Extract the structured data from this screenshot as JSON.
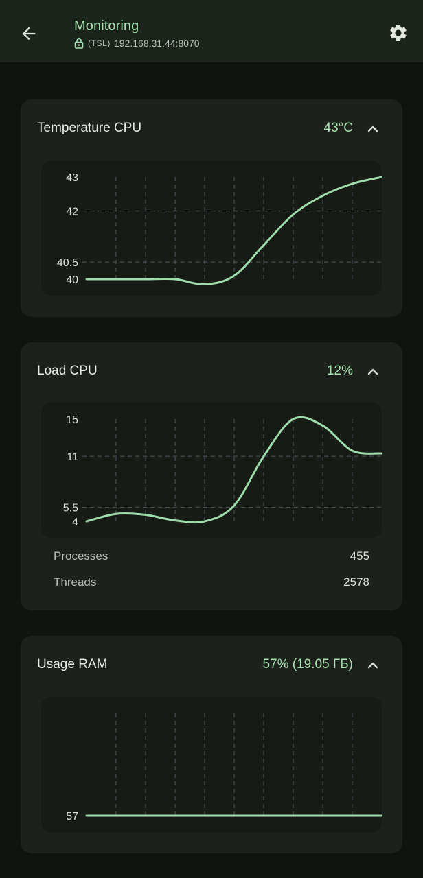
{
  "app_bar": {
    "title": "Monitoring",
    "protocol": "(TSL)",
    "address": "192.168.31.44:8070",
    "back_icon": "arrow-left-icon",
    "settings_icon": "gear-icon",
    "lock_icon": "lock-icon"
  },
  "colors": {
    "accent": "#a6e3b0",
    "line": "#9fdcab",
    "card": "#1c211c",
    "background": "#0f140f"
  },
  "cards": {
    "temperature": {
      "title": "Temperature CPU",
      "value": "43°C",
      "chevron_icon": "chevron-up-icon"
    },
    "load": {
      "title": "Load CPU",
      "value": "12%",
      "chevron_icon": "chevron-up-icon",
      "processes_label": "Processes",
      "processes_value": "455",
      "threads_label": "Threads",
      "threads_value": "2578"
    },
    "ram": {
      "title": "Usage RAM",
      "value": "57% (19.05 ГБ)",
      "chevron_icon": "chevron-up-icon"
    }
  },
  "chart_data": [
    {
      "type": "line",
      "title": "Temperature CPU",
      "yticks": [
        "43",
        "42",
        "40.5",
        "40"
      ],
      "ylim": [
        40,
        43
      ],
      "grid": true,
      "series": [
        {
          "x": [
            0,
            1,
            2,
            3,
            4,
            5,
            6,
            7,
            8,
            9,
            10
          ],
          "y": [
            40,
            40,
            40,
            40,
            39.85,
            40.1,
            41,
            41.9,
            42.45,
            42.8,
            43
          ]
        }
      ]
    },
    {
      "type": "line",
      "title": "Load CPU",
      "yticks": [
        "15",
        "11",
        "5.5",
        "4"
      ],
      "ylim": [
        4,
        15
      ],
      "grid": true,
      "series": [
        {
          "x": [
            0,
            1,
            2,
            3,
            4,
            5,
            6,
            7,
            8,
            9,
            10
          ],
          "y": [
            4,
            4.8,
            4.7,
            4.1,
            4,
            5.7,
            11,
            15,
            14.3,
            11.6,
            11.3
          ]
        }
      ]
    },
    {
      "type": "line",
      "title": "Usage RAM",
      "yticks": [
        "57"
      ],
      "ylim": [
        57,
        57
      ],
      "grid": true,
      "series": [
        {
          "x": [
            0,
            1,
            2,
            3,
            4,
            5,
            6,
            7,
            8,
            9,
            10
          ],
          "y": [
            57,
            57,
            57,
            57,
            57,
            57,
            57,
            57,
            57,
            57,
            57
          ]
        }
      ]
    }
  ]
}
